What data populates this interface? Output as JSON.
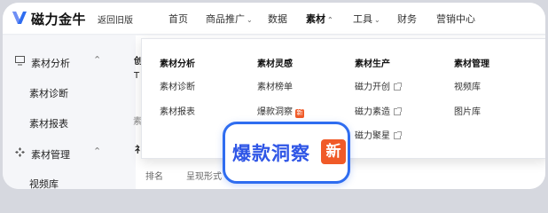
{
  "app": {
    "brand": "磁力金牛",
    "back_link": "返回旧版",
    "accent": "#2f6df0",
    "badge_color": "#f05a28"
  },
  "nav": {
    "items": [
      {
        "label": "首页"
      },
      {
        "label": "商品推广",
        "caret": "⌄"
      },
      {
        "label": "数据"
      },
      {
        "label": "素材",
        "caret": "⌃",
        "active": true
      },
      {
        "label": "工具",
        "caret": "⌄"
      },
      {
        "label": "财务"
      },
      {
        "label": "营销中心"
      }
    ]
  },
  "sidebar": {
    "groups": [
      {
        "label": "素材分析",
        "icon": "monitor-icon",
        "chevron": "⌃"
      },
      {
        "label": "素材诊断"
      },
      {
        "label": "素材报表"
      },
      {
        "label": "素材管理",
        "icon": "diamond-grid-icon",
        "chevron": "⌃"
      },
      {
        "label": "视频库"
      }
    ]
  },
  "main": {
    "frag_1": "创",
    "frag_2": "T",
    "frag_3": "素",
    "frag_4": "礻",
    "headers": [
      "排名",
      "呈现形式"
    ]
  },
  "dropdown": {
    "columns": [
      {
        "title": "素材分析",
        "items": [
          {
            "label": "素材诊断"
          },
          {
            "label": "素材报表"
          }
        ]
      },
      {
        "title": "素材灵感",
        "items": [
          {
            "label": "素材榜单"
          },
          {
            "label": "爆款洞察",
            "badge": "新"
          }
        ]
      },
      {
        "title": "素材生产",
        "items": [
          {
            "label": "磁力开创",
            "external": true
          },
          {
            "label": "磁力素造",
            "external": true
          },
          {
            "label": "磁力聚星",
            "external": true
          }
        ]
      },
      {
        "title": "素材管理",
        "items": [
          {
            "label": "视频库"
          },
          {
            "label": "图片库"
          }
        ]
      }
    ]
  },
  "callout": {
    "text": "爆款洞察",
    "badge": "新"
  }
}
